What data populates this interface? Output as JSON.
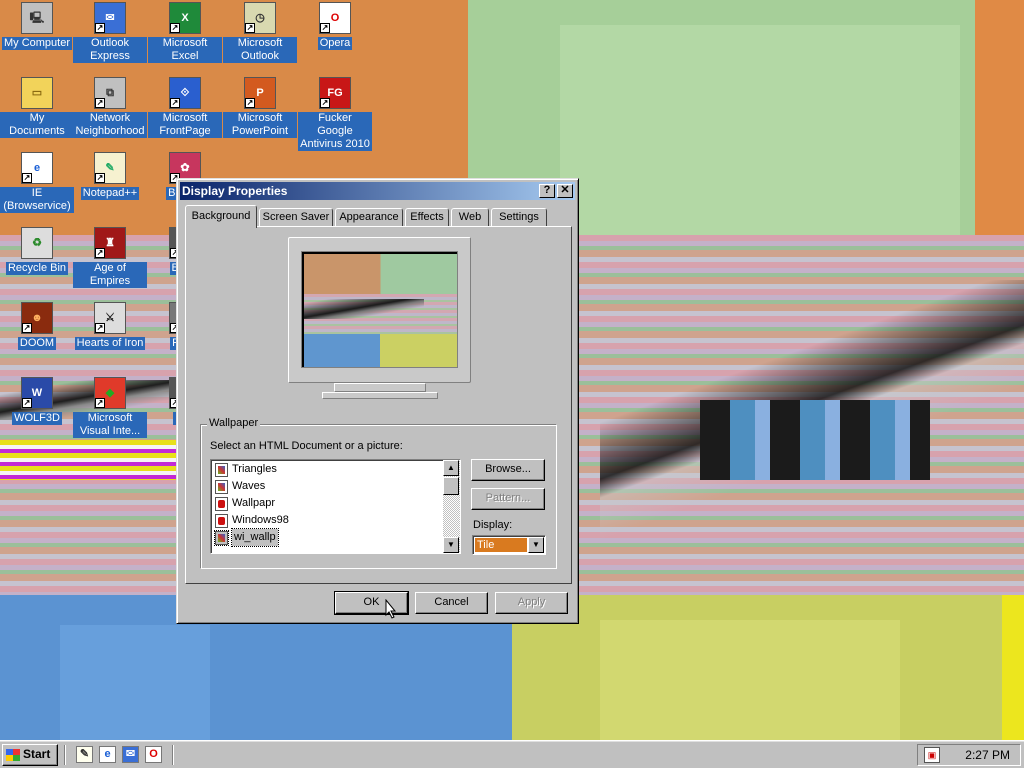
{
  "desktop": {
    "icons": [
      {
        "label": "My Computer",
        "icon": "computer-icon"
      },
      {
        "label": "Outlook Express",
        "icon": "outlook-express-icon"
      },
      {
        "label": "Microsoft Excel",
        "icon": "excel-icon"
      },
      {
        "label": "Microsoft Outlook",
        "icon": "outlook-icon"
      },
      {
        "label": "Opera",
        "icon": "opera-icon"
      },
      {
        "label": "My Documents",
        "icon": "folder-icon"
      },
      {
        "label": "Network Neighborhood",
        "icon": "network-icon"
      },
      {
        "label": "Microsoft FrontPage",
        "icon": "frontpage-icon"
      },
      {
        "label": "Microsoft PowerPoint",
        "icon": "powerpoint-icon"
      },
      {
        "label": "Fucker Google Antivirus 2010",
        "icon": "antivirus-icon"
      },
      {
        "label": "IE (Browservice)",
        "icon": "internet-explorer-icon"
      },
      {
        "label": "Notepad++",
        "icon": "notepad-icon"
      },
      {
        "label": "Bete D",
        "icon": "bete-icon"
      },
      {
        "label": "Recycle Bin",
        "icon": "recycle-bin-icon"
      },
      {
        "label": "Age of Empires",
        "icon": "age-of-empires-icon"
      },
      {
        "label": "Big D",
        "icon": "big-icon"
      },
      {
        "label": "DOOM",
        "icon": "doom-icon"
      },
      {
        "label": "Hearts of Iron",
        "icon": "hearts-of-iron-icon"
      },
      {
        "label": "Pagg",
        "icon": "pagg-icon"
      },
      {
        "label": "WOLF3D",
        "icon": "wolf3d-icon"
      },
      {
        "label": "Microsoft Visual Inte...",
        "icon": "visual-interdev-icon"
      },
      {
        "label": "Pl Z",
        "icon": "pl-icon"
      }
    ]
  },
  "dialog": {
    "title": "Display Properties",
    "help_button": "?",
    "close_button": "✕",
    "tabs": [
      "Background",
      "Screen Saver",
      "Appearance",
      "Effects",
      "Web",
      "Settings"
    ],
    "active_tab": "Background",
    "wallpaper_group": "Wallpaper",
    "select_label": "Select an HTML Document or a picture:",
    "files": [
      {
        "name": "Triangles",
        "type": "pic"
      },
      {
        "name": "Waves",
        "type": "pic"
      },
      {
        "name": "Wallpapr",
        "type": "red"
      },
      {
        "name": "Windows98",
        "type": "red"
      },
      {
        "name": "wi_wallp",
        "type": "pic",
        "selected": true
      }
    ],
    "browse_button": "Browse...",
    "pattern_button": "Pattern...",
    "display_label": "Display:",
    "display_value": "Tile",
    "ok_button": "OK",
    "cancel_button": "Cancel",
    "apply_button": "Apply"
  },
  "taskbar": {
    "start_label": "Start",
    "quick_launch": [
      "show-desktop-icon",
      "ie-icon",
      "outlook-express-icon",
      "opera-icon"
    ],
    "clock": "2:27 PM"
  },
  "colors": {
    "titlebar_start": "#0a246a",
    "titlebar_end": "#a6caf0",
    "face": "#c0c0c0",
    "desktop_orange": "#d98a48",
    "desktop_green": "#a7d09a"
  }
}
